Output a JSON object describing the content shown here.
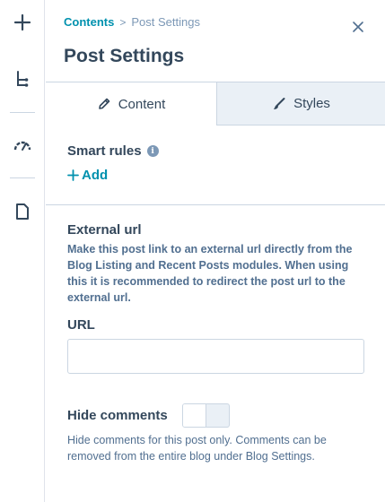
{
  "rail": {
    "items": [
      {
        "icon": "plus-icon"
      },
      {
        "icon": "tree-structure-icon"
      },
      {
        "icon": "speedometer-icon"
      },
      {
        "icon": "document-icon"
      }
    ]
  },
  "breadcrumb": {
    "parent": "Contents",
    "separator": ">",
    "current": "Post Settings"
  },
  "panel": {
    "title": "Post Settings",
    "close_icon": "close-icon"
  },
  "tabs": [
    {
      "label": "Content",
      "icon": "pencil-icon",
      "active": true
    },
    {
      "label": "Styles",
      "icon": "brush-icon",
      "active": false
    }
  ],
  "smart_rules": {
    "label": "Smart rules",
    "info_glyph": "i",
    "add_label": "Add"
  },
  "external_url": {
    "title": "External url",
    "description": "Make this post link to an external url directly from the Blog Listing and Recent Posts modules. When using this it is recommended to redirect the post url to the external url.",
    "field_label": "URL",
    "value": ""
  },
  "hide_comments": {
    "label": "Hide comments",
    "enabled": false,
    "description": "Hide comments for this post only. Comments can be removed from the entire blog under Blog Settings."
  },
  "colors": {
    "accent": "#0091ae",
    "text": "#33475b",
    "muted": "#516f90",
    "border": "#cbd6e2",
    "tab_inactive_bg": "#eaf0f6"
  }
}
